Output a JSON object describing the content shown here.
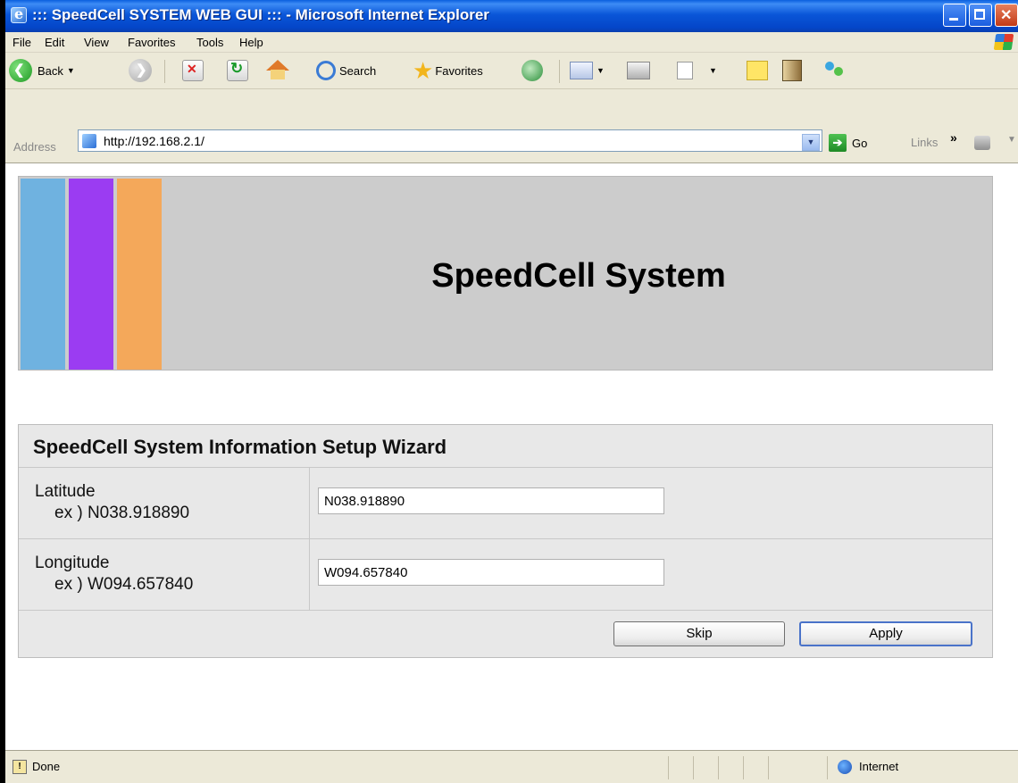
{
  "window": {
    "title": "::: SpeedCell SYSTEM WEB GUI ::: - Microsoft Internet Explorer"
  },
  "menu": {
    "items": [
      "File",
      "Edit",
      "View",
      "Favorites",
      "Tools",
      "Help"
    ]
  },
  "toolbar": {
    "back_label": "Back",
    "search_label": "Search",
    "favorites_label": "Favorites"
  },
  "address": {
    "label": "Address",
    "url": "http://192.168.2.1/",
    "go_label": "Go",
    "links_label": "Links"
  },
  "page": {
    "banner_title": "SpeedCell System",
    "banner_colors": [
      "#6fb2e0",
      "#9b3cf2",
      "#f4a85a"
    ],
    "wizard": {
      "title": "SpeedCell System Information Setup Wizard",
      "latitude_label": "Latitude",
      "latitude_example": "ex ) N038.918890",
      "latitude_value": "N038.918890",
      "longitude_label": "Longitude",
      "longitude_example": "ex ) W094.657840",
      "longitude_value": "W094.657840",
      "skip_label": "Skip",
      "apply_label": "Apply"
    }
  },
  "status": {
    "text": "Done",
    "zone": "Internet"
  }
}
